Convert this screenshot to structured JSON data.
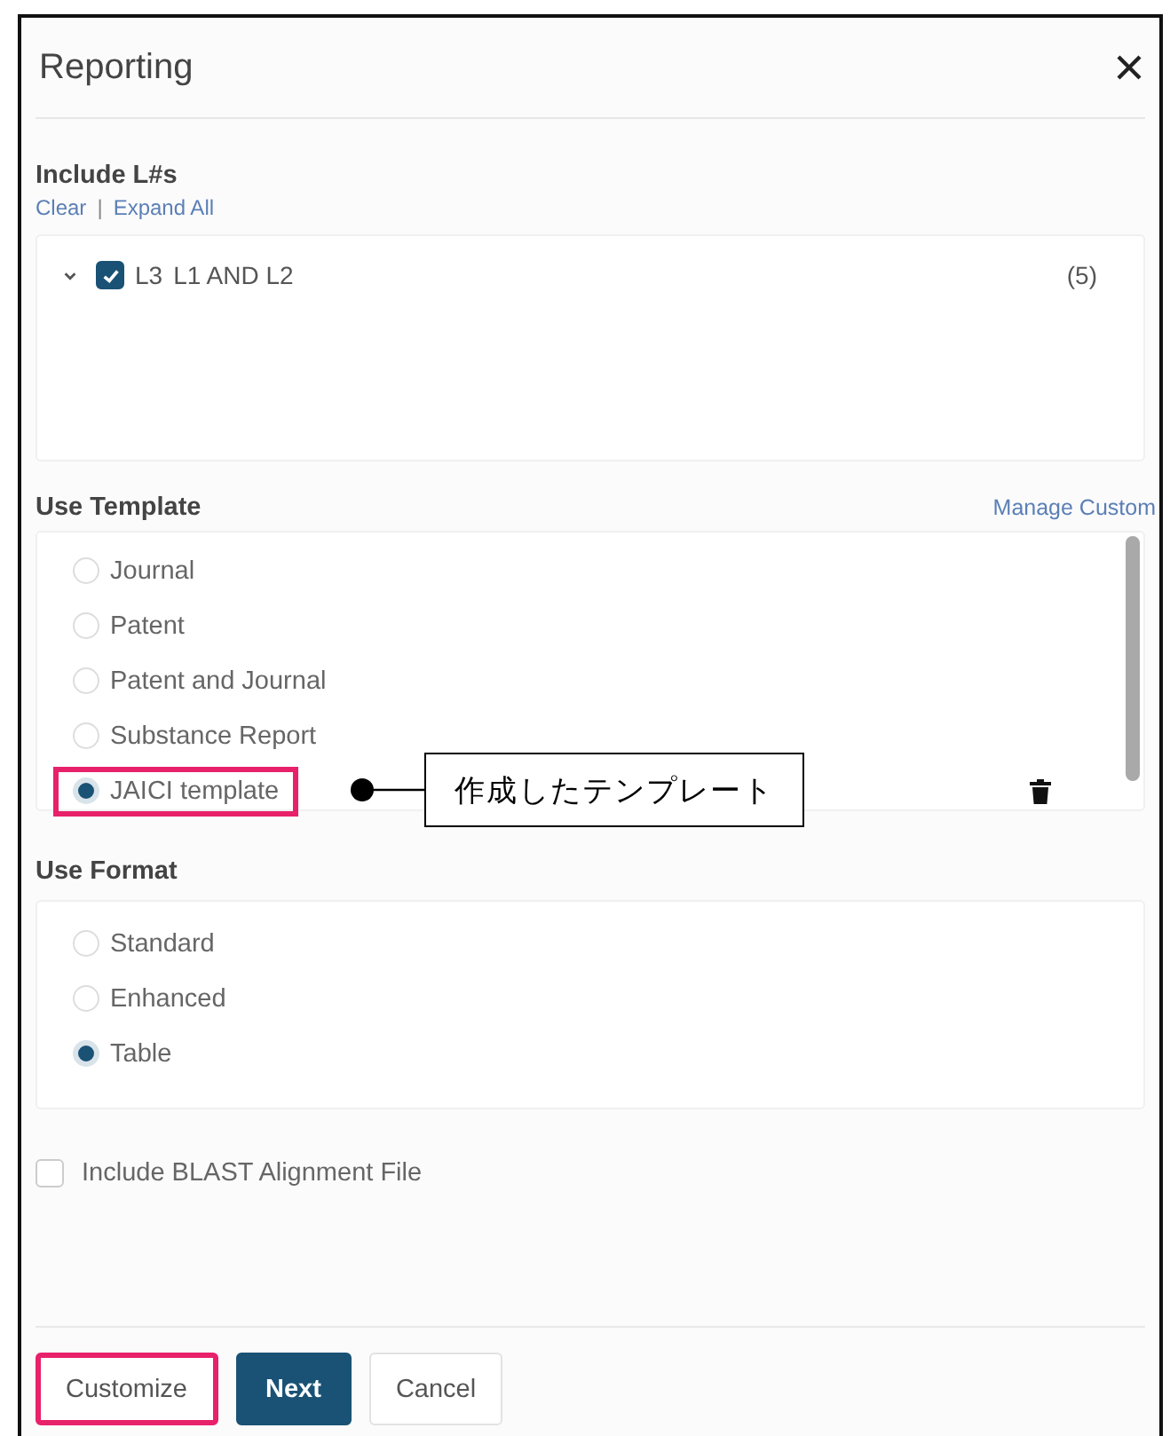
{
  "dialog": {
    "title": "Reporting"
  },
  "include": {
    "heading": "Include L#s",
    "links": [
      "Clear",
      "Expand All"
    ],
    "separator": "|",
    "tree": [
      {
        "id": "L3",
        "label": "L1 AND L2",
        "count": "(5)",
        "checked": true,
        "expanded": true
      }
    ]
  },
  "template": {
    "heading": "Use Template",
    "link": "Manage Custom",
    "options": [
      {
        "label": "Journal",
        "selected": false,
        "highlighted": false,
        "deletable": false
      },
      {
        "label": "Patent",
        "selected": false,
        "highlighted": false,
        "deletable": false
      },
      {
        "label": "Patent and Journal",
        "selected": false,
        "highlighted": false,
        "deletable": false
      },
      {
        "label": "Substance Report",
        "selected": false,
        "highlighted": false,
        "deletable": false
      },
      {
        "label": "JAICI template",
        "selected": true,
        "highlighted": true,
        "deletable": true,
        "callout": "作成したテンプレート"
      }
    ]
  },
  "format": {
    "heading": "Use Format",
    "options": [
      {
        "label": "Standard",
        "selected": false
      },
      {
        "label": "Enhanced",
        "selected": false
      },
      {
        "label": "Table",
        "selected": true
      }
    ]
  },
  "blast": {
    "label": "Include BLAST Alignment File",
    "checked": false
  },
  "buttons": [
    {
      "label": "Customize",
      "kind": "secondary",
      "highlighted": true
    },
    {
      "label": "Next",
      "kind": "primary",
      "highlighted": false
    },
    {
      "label": "Cancel",
      "kind": "secondary",
      "highlighted": false
    }
  ]
}
